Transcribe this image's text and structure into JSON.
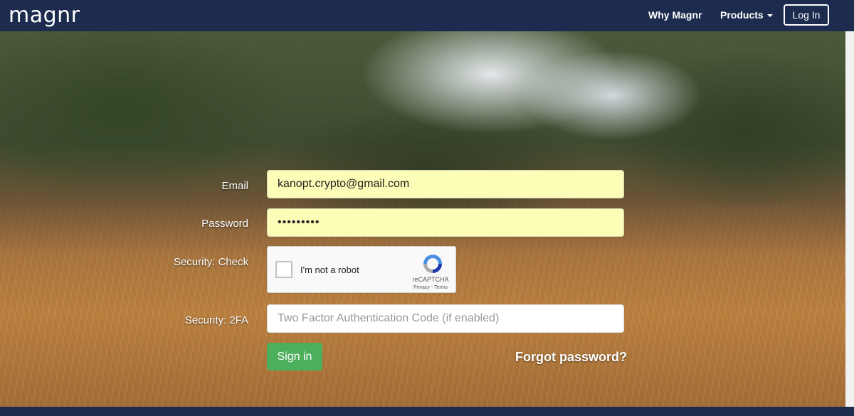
{
  "navbar": {
    "brand": "magnr",
    "why_label": "Why Magnr",
    "products_label": "Products",
    "login_label": "Log In"
  },
  "form": {
    "email_label": "Email",
    "email_value": "kanopt.crypto@gmail.com",
    "password_label": "Password",
    "password_value": "•••••••••",
    "security_check_label": "Security: Check",
    "security_2fa_label": "Security: 2FA",
    "twofa_placeholder": "Two Factor Authentication Code (if enabled)",
    "signin_label": "Sign in",
    "forgot_label": "Forgot password?"
  },
  "captcha": {
    "checkbox_label": "I'm not a robot",
    "brand": "reCAPTCHA",
    "links": "Privacy - Terms",
    "icon": "recaptcha-logo-icon"
  },
  "colors": {
    "navbar": "#1d2b4f",
    "autofill_bg": "#fcfdb6",
    "signin_bg": "#4caf5b"
  }
}
